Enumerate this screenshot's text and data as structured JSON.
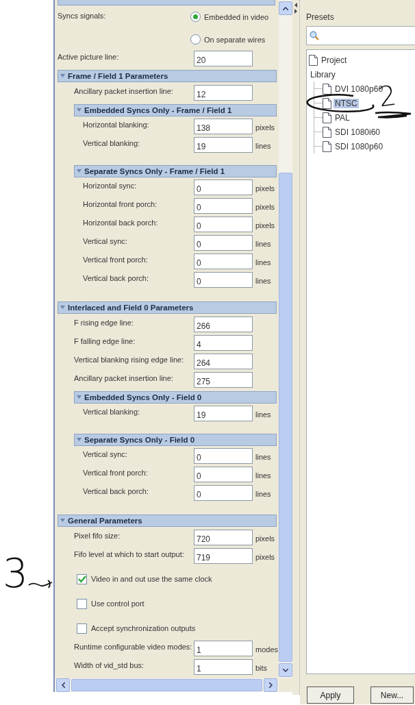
{
  "form": {
    "items": [
      {
        "kind": "radio_group",
        "label": "Syncs signals:",
        "options": [
          {
            "label": "Embedded in video",
            "selected": true
          },
          {
            "label": "On separate wires",
            "selected": false
          }
        ]
      },
      {
        "kind": "field",
        "label": "Active picture line:",
        "value": "20"
      },
      {
        "kind": "section",
        "title": "Frame / Field 1 Parameters",
        "expanded": true,
        "items": [
          {
            "kind": "field",
            "label": "Ancillary packet insertion line:",
            "value": "12"
          },
          {
            "kind": "section",
            "title": "Embedded Syncs Only - Frame / Field 1",
            "expanded": true,
            "items": [
              {
                "kind": "field",
                "label": "Horizontal blanking:",
                "value": "138",
                "unit": "pixels"
              },
              {
                "kind": "field",
                "label": "Vertical blanking:",
                "value": "19",
                "unit": "lines"
              }
            ]
          },
          {
            "kind": "section",
            "title": "Separate Syncs Only - Frame / Field 1",
            "expanded": true,
            "items": [
              {
                "kind": "field",
                "label": "Horizontal sync:",
                "value": "0",
                "unit": "pixels"
              },
              {
                "kind": "field",
                "label": "Horizontal front porch:",
                "value": "0",
                "unit": "pixels"
              },
              {
                "kind": "field",
                "label": "Horizontal back porch:",
                "value": "0",
                "unit": "pixels"
              },
              {
                "kind": "field",
                "label": "Vertical sync:",
                "value": "0",
                "unit": "lines"
              },
              {
                "kind": "field",
                "label": "Vertical front porch:",
                "value": "0",
                "unit": "lines"
              },
              {
                "kind": "field",
                "label": "Vertical back porch:",
                "value": "0",
                "unit": "lines"
              }
            ]
          }
        ]
      },
      {
        "kind": "section",
        "title": "Interlaced and Field 0 Parameters",
        "expanded": true,
        "items": [
          {
            "kind": "field",
            "label": "F rising edge line:",
            "value": "266"
          },
          {
            "kind": "field",
            "label": "F falling edge line:",
            "value": "4"
          },
          {
            "kind": "field",
            "label": "Vertical blanking rising edge line:",
            "value": "264"
          },
          {
            "kind": "field",
            "label": "Ancillary packet insertion line:",
            "value": "275"
          },
          {
            "kind": "section",
            "title": "Embedded Syncs Only - Field 0",
            "expanded": true,
            "items": [
              {
                "kind": "field",
                "label": "Vertical blanking:",
                "value": "19",
                "unit": "lines"
              }
            ]
          },
          {
            "kind": "section",
            "title": "Separate Syncs Only - Field 0",
            "expanded": true,
            "items": [
              {
                "kind": "field",
                "label": "Vertical sync:",
                "value": "0",
                "unit": "lines"
              },
              {
                "kind": "field",
                "label": "Vertical front porch:",
                "value": "0",
                "unit": "lines"
              },
              {
                "kind": "field",
                "label": "Vertical back porch:",
                "value": "0",
                "unit": "lines"
              }
            ]
          }
        ]
      },
      {
        "kind": "section",
        "title": "General Parameters",
        "expanded": true,
        "items": [
          {
            "kind": "field",
            "label": "Pixel fifo size:",
            "value": "720",
            "unit": "pixels"
          },
          {
            "kind": "field",
            "label": "Fifo level at which to start output:",
            "value": "719",
            "unit": "pixels"
          },
          {
            "kind": "checkbox",
            "label": "Video in and out use the same clock",
            "checked": true
          },
          {
            "kind": "checkbox",
            "label": "Use control port",
            "checked": false
          },
          {
            "kind": "checkbox",
            "label": "Accept synchronization outputs",
            "checked": false
          },
          {
            "kind": "field",
            "label": "Runtime configurable video modes:",
            "value": "1",
            "unit": "modes"
          },
          {
            "kind": "field",
            "label": "Width of vid_std bus:",
            "value": "1",
            "unit": "bits"
          }
        ]
      }
    ]
  },
  "presets": {
    "title": "Presets",
    "tree": [
      {
        "label": "Project",
        "icon": true,
        "selected": false
      },
      {
        "label": "Library",
        "icon": false,
        "selected": false,
        "children": [
          {
            "label": "DVI 1080p60",
            "icon": true,
            "selected": false
          },
          {
            "label": "NTSC",
            "icon": true,
            "selected": true
          },
          {
            "label": "PAL",
            "icon": true,
            "selected": false
          },
          {
            "label": "SDI 1080i60",
            "icon": true,
            "selected": false
          },
          {
            "label": "SDI 1080p60",
            "icon": true,
            "selected": false
          }
        ]
      }
    ],
    "buttons": [
      "Apply",
      "New..."
    ]
  },
  "annotations": [
    {
      "text": "3"
    },
    {
      "text": "2"
    }
  ]
}
